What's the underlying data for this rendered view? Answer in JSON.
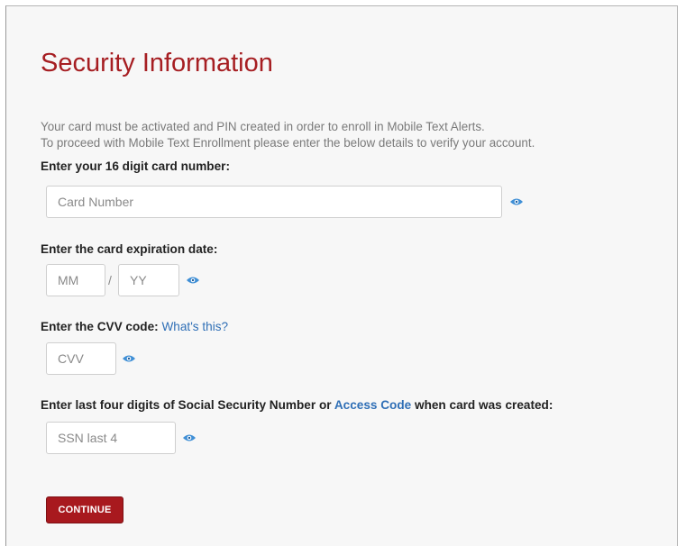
{
  "page": {
    "title": "Security Information",
    "intro_line1": "Your card must be activated and PIN created in order to enroll in Mobile Text Alerts.",
    "intro_line2": "To proceed with Mobile Text Enrollment please enter the below details to verify your account."
  },
  "card_number": {
    "label": "Enter your 16 digit card number:",
    "placeholder": "Card Number"
  },
  "expiration": {
    "label": "Enter the card expiration date:",
    "month_placeholder": "MM",
    "separator": "/",
    "year_placeholder": "YY"
  },
  "cvv": {
    "label": "Enter the CVV code:",
    "help_link": "What's this?",
    "placeholder": "CVV"
  },
  "ssn": {
    "label_prefix": "Enter last four digits of Social Security Number or",
    "access_code_link": "Access Code",
    "label_suffix": "when card was created:",
    "placeholder": "SSN last 4"
  },
  "actions": {
    "continue_label": "CONTINUE"
  },
  "icons": {
    "reveal": "eye-icon"
  },
  "colors": {
    "title": "#a61e22",
    "link": "#2f6fb6",
    "button": "#a8191e",
    "eye": "#3f8fd6"
  }
}
